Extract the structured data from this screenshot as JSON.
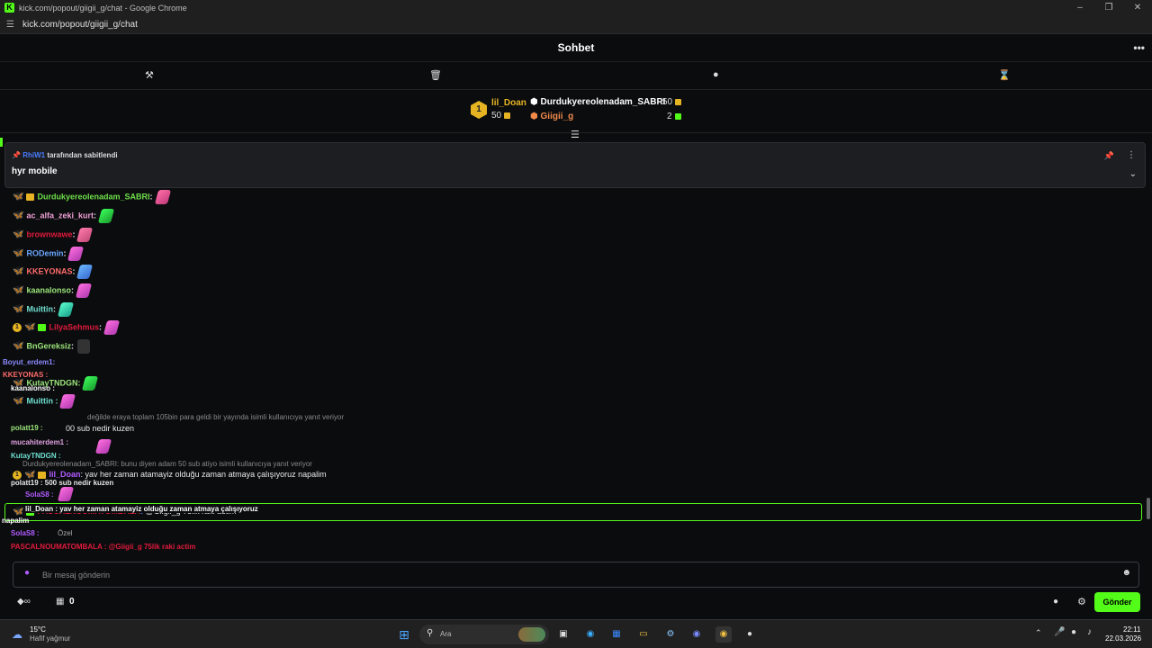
{
  "window": {
    "title": "kick.com/popout/giigii_g/chat - Google Chrome",
    "url": "kick.com/popout/giigii_g/chat"
  },
  "chat": {
    "title": "Sohbet",
    "more": "•••"
  },
  "leaderboard": {
    "rank": "1",
    "first": {
      "name": "lil_Doan",
      "count": "50"
    },
    "second": {
      "name": "Durdukyereolenadam_SABRI",
      "count": "50"
    },
    "third": {
      "name": "Giigii_g",
      "count": "2"
    }
  },
  "pinned": {
    "by_user": "RhiW1",
    "by_text": "tarafından sabitlendi",
    "message": "hyr mobile"
  },
  "messages": [
    {
      "user": "Durdukyereolenadam_SABRI",
      "color": "#6ee04a"
    },
    {
      "user": "ac_alfa_zeki_kurt",
      "color": "#f1a1d8"
    },
    {
      "user": "brownwawe",
      "color": "#e01a3c"
    },
    {
      "user": "RODemin",
      "color": "#6aa6ff"
    },
    {
      "user": "KKEYONAS",
      "color": "#ff6b6b"
    },
    {
      "user": "kaanalonso",
      "color": "#9be67a"
    },
    {
      "user": "Muittin",
      "color": "#6ee0d0"
    },
    {
      "user": "LilyaSehmus",
      "color": "#e01a3c"
    },
    {
      "user": "BnGereksiz",
      "color": "#9be67a"
    }
  ],
  "overlay_messages": [
    {
      "text": "Boyut_erdem1:",
      "color": "#8a8aff"
    },
    {
      "text": "KKEYONAS :",
      "color": "#ff6b6b"
    },
    {
      "text": "KutayTNDGN:",
      "color": "#9be67a"
    },
    {
      "text": "kaanalonso :",
      "color": "#9be67a"
    },
    {
      "text": "Muittin :",
      "color": "#6ee0d0"
    },
    {
      "text": "polatt19 :",
      "color": "#9be67a"
    },
    {
      "text": "mucahiterdem1 :",
      "color": "#e0a0e0"
    },
    {
      "text": "KutayTNDGN :",
      "color": "#6ee0d0"
    },
    {
      "text": "polatt19 : 500 sub nedir kuzen",
      "color": "#e8e8e8"
    },
    {
      "text": "SolaS8 :",
      "color": "#b05cff"
    },
    {
      "text": "lil_Doan : yav her zaman atamayiz olduğu zaman atmaya çalışıyoruz",
      "color": "#e8e8e8"
    },
    {
      "text": "napalim",
      "color": "#e8e8e8"
    },
    {
      "text": "SolaS8 :",
      "color": "#b05cff"
    },
    {
      "text": "PASCALNOUMATOMBALA : @Giigii_g 75lik raki actim",
      "color": "#e01a3c"
    }
  ],
  "replies": [
    {
      "text": "değilde eraya toplam 105bin para geldi bir yayında isimli kullanıcıya yanıt veriyor"
    },
    {
      "text": "Durdukyereolenadam_SABRI: bunu diyen adam 50 sub atiyo isimli kullanıcıya yanıt veriyor"
    }
  ],
  "normal_messages": [
    {
      "text": "00 sub nedir kuzen"
    },
    {
      "user": "lil_Doan",
      "text": "yav her zaman atamayiz olduğu zaman atmaya çalışıyoruz napalim"
    },
    {
      "user": "PASCALNOUMATOMBALA",
      "text": "@Giigii_g 75lik raki actim"
    },
    {
      "text": "Özel"
    }
  ],
  "input": {
    "placeholder": "Bir mesaj gönderin"
  },
  "bottom": {
    "points": "0",
    "send": "Gönder"
  },
  "taskbar": {
    "weather_temp": "15°C",
    "weather_desc": "Hafif yağmur",
    "search": "Ara",
    "time": "22:11",
    "date": "22.03.2026"
  },
  "colors": {
    "accent": "#53fc18",
    "background": "#0b0c0e",
    "gold": "#e6b422"
  }
}
